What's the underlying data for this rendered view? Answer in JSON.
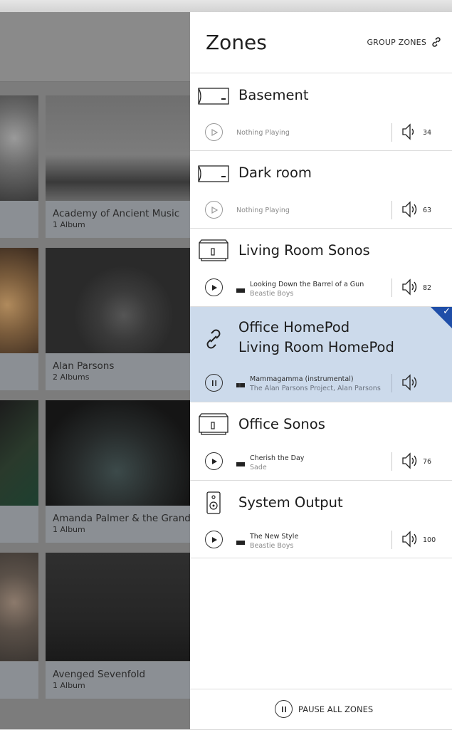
{
  "panel": {
    "title": "Zones",
    "group_label": "GROUP ZONES",
    "pause_all_label": "PAUSE ALL ZONES"
  },
  "library": {
    "artists": [
      {
        "name": "Academy of Ancient Music",
        "count": "1 Album"
      },
      {
        "name": "Alan Parsons",
        "count": "2 Albums"
      },
      {
        "name": "Amanda Palmer & the Grand",
        "count": "1 Album"
      },
      {
        "name": "Avenged Sevenfold",
        "count": "1 Album"
      }
    ]
  },
  "zones": [
    {
      "name": "Basement",
      "device": "speaker-wide-icon",
      "status": "Nothing Playing",
      "volume": "34"
    },
    {
      "name": "Dark room",
      "device": "speaker-wide-icon",
      "status": "Nothing Playing",
      "volume": "63"
    },
    {
      "name": "Living Room Sonos",
      "device": "speaker-box-icon",
      "track": "Looking Down the Barrel of a Gun",
      "artist": "Beastie Boys",
      "volume": "82"
    },
    {
      "name_line1": "Office HomePod",
      "name_line2": "Living Room HomePod",
      "device": "link-icon",
      "track": "Mammagamma (instrumental)",
      "artist": "The Alan Parsons Project, Alan Parsons",
      "selected": true
    },
    {
      "name": "Office Sonos",
      "device": "speaker-box-icon",
      "track": "Cherish the Day",
      "artist": "Sade",
      "volume": "76"
    },
    {
      "name": "System Output",
      "device": "speaker-tower-icon",
      "track": "The New Style",
      "artist": "Beastie Boys",
      "volume": "100"
    }
  ],
  "colors": {
    "selected_bg": "#ccdaeb",
    "check_accent": "#1f4ea8"
  }
}
